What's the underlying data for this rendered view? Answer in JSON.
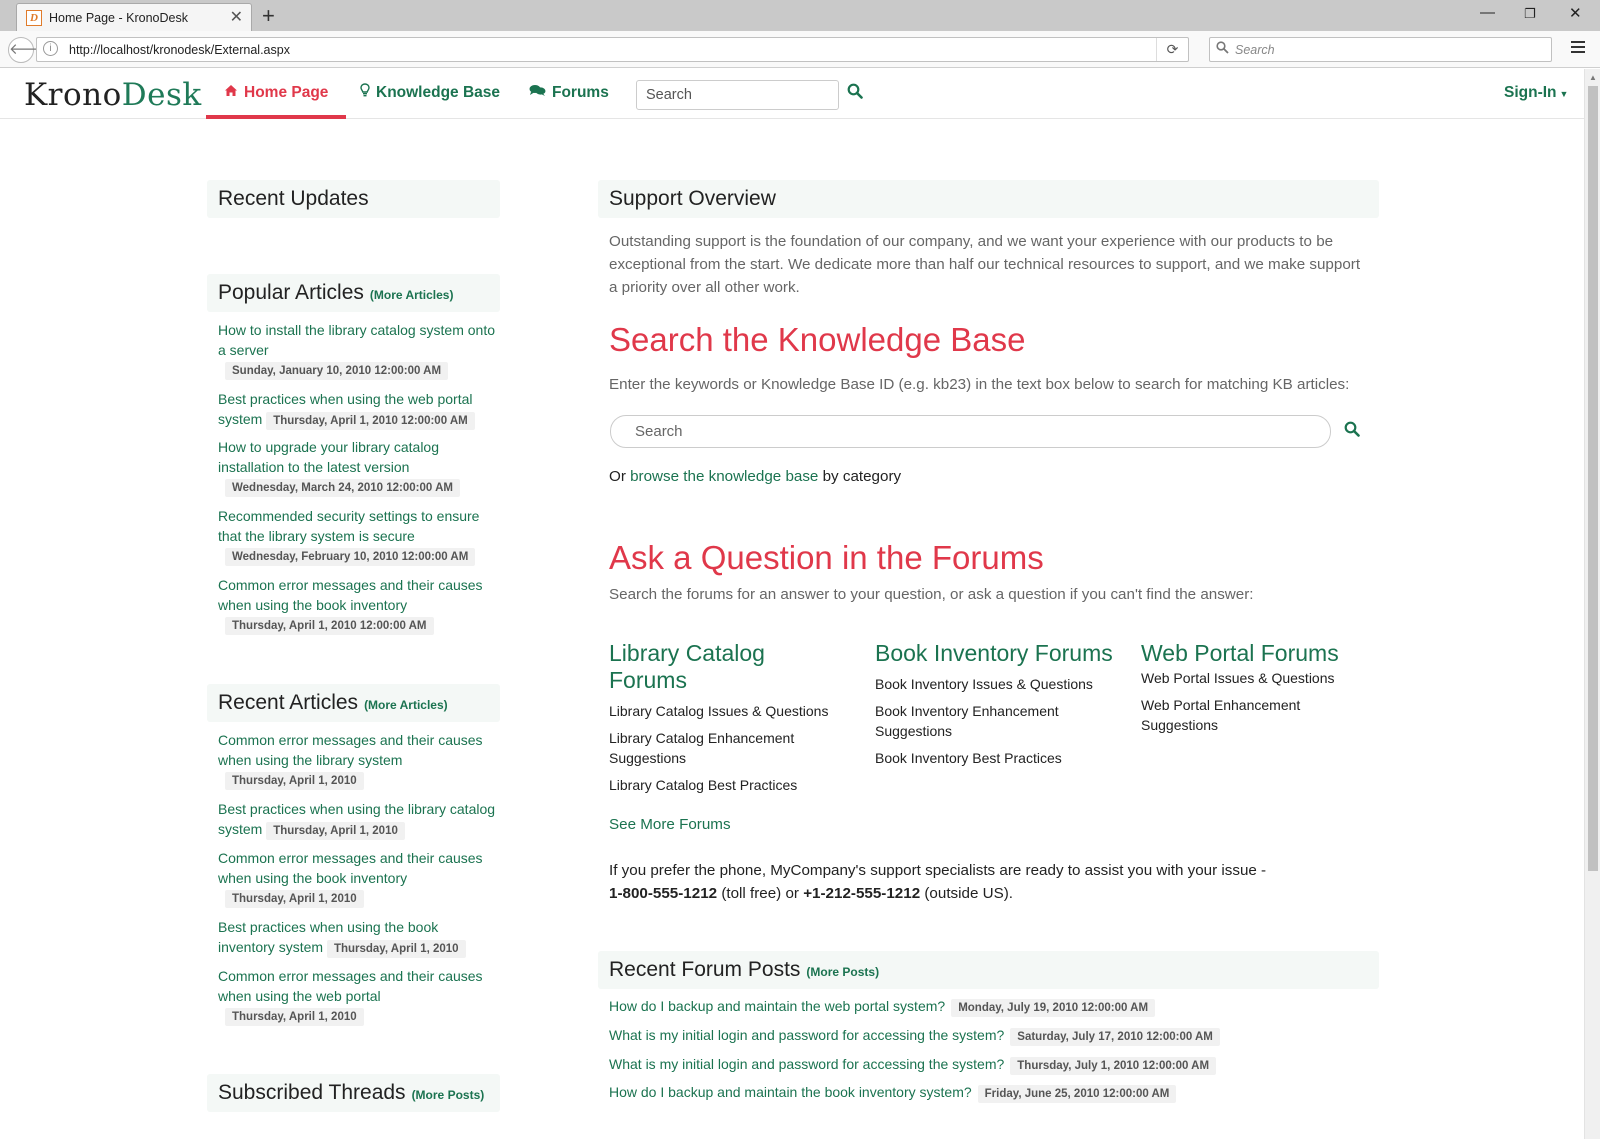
{
  "browser": {
    "tab_title": "Home Page - KronoDesk",
    "url": "http://localhost/kronodesk/External.aspx",
    "search_placeholder": "Search"
  },
  "site": {
    "logo_prefix": "Krono",
    "logo_suffix": "Desk",
    "nav": {
      "home": "Home Page",
      "kb": "Knowledge Base",
      "forums": "Forums"
    },
    "search_placeholder": "Search",
    "signin": "Sign-In"
  },
  "left": {
    "recent_updates_title": "Recent Updates",
    "popular_title": "Popular Articles",
    "popular_more": "(More Articles)",
    "popular": [
      {
        "title": "How to install the library catalog system onto a server",
        "date": "Sunday, January 10, 2010 12:00:00 AM"
      },
      {
        "title": "Best practices when using the web portal system",
        "date": "Thursday, April 1, 2010 12:00:00 AM"
      },
      {
        "title": "How to upgrade your library catalog installation to the latest version",
        "date": "Wednesday, March 24, 2010 12:00:00 AM"
      },
      {
        "title": "Recommended security settings to ensure that the library system is secure",
        "date": "Wednesday, February 10, 2010 12:00:00 AM"
      },
      {
        "title": "Common error messages and their causes when using the book inventory",
        "date": "Thursday, April 1, 2010 12:00:00 AM"
      }
    ],
    "recent_title": "Recent Articles",
    "recent_more": "(More Articles)",
    "recent": [
      {
        "title": "Common error messages and their causes when using the library system",
        "date": "Thursday, April 1, 2010"
      },
      {
        "title": "Best practices when using the library catalog system",
        "date": "Thursday, April 1, 2010"
      },
      {
        "title": "Common error messages and their causes when using the book inventory",
        "date": "Thursday, April 1, 2010"
      },
      {
        "title": "Best practices when using the book inventory system",
        "date": "Thursday, April 1, 2010"
      },
      {
        "title": "Common error messages and their causes when using the web portal",
        "date": "Thursday, April 1, 2010"
      }
    ],
    "subscribed_title": "Subscribed Threads",
    "subscribed_more": "(More Posts)"
  },
  "main": {
    "overview_title": "Support Overview",
    "overview_text": "Outstanding support is the foundation of our company, and we want your experience with our products to be exceptional from the start. We dedicate more than half our technical resources to support, and we make support a priority over all other work.",
    "kb_heading": "Search the Knowledge Base",
    "kb_instructions": "Enter the keywords or Knowledge Base ID (e.g. kb23) in the text box below to search for matching KB articles:",
    "kb_search_placeholder": "Search",
    "browse_prefix": "Or ",
    "browse_link": "browse the knowledge base",
    "browse_suffix": " by category",
    "forums_heading": "Ask a Question in the Forums",
    "forums_instructions": "Search the forums for an answer to your question, or ask a question if you can't find the answer:",
    "forum_groups": [
      {
        "title": "Library Catalog Forums",
        "items": [
          "Library Catalog Issues & Questions",
          "Library Catalog Enhancement Suggestions",
          "Library Catalog Best Practices"
        ]
      },
      {
        "title": "Book Inventory Forums",
        "items": [
          "Book Inventory Issues & Questions",
          "Book Inventory Enhancement Suggestions",
          "Book Inventory Best Practices"
        ]
      },
      {
        "title": "Web Portal Forums",
        "items": [
          "Web Portal Issues & Questions",
          "Web Portal Enhancement Suggestions"
        ]
      }
    ],
    "see_more_forums": "See More Forums",
    "phone_text": "If you prefer the phone, MyCompany's support specialists are ready to assist you with your issue -",
    "phone_tollfree": "1-800-555-1212",
    "phone_tollfree_label": " (toll free) or ",
    "phone_intl": "+1-212-555-1212",
    "phone_intl_label": " (outside US).",
    "recent_posts_title": "Recent Forum Posts",
    "recent_posts_more": "(More Posts)",
    "recent_posts": [
      {
        "title": "How do I backup and maintain the web portal system?",
        "date": "Monday, July 19, 2010 12:00:00 AM"
      },
      {
        "title": "What is my initial login and password for accessing the system?",
        "date": "Saturday, July 17, 2010 12:00:00 AM"
      },
      {
        "title": "What is my initial login and password for accessing the system?",
        "date": "Thursday, July 1, 2010 12:00:00 AM"
      },
      {
        "title": "How do I backup and maintain the book inventory system?",
        "date": "Friday, June 25, 2010 12:00:00 AM"
      }
    ]
  }
}
